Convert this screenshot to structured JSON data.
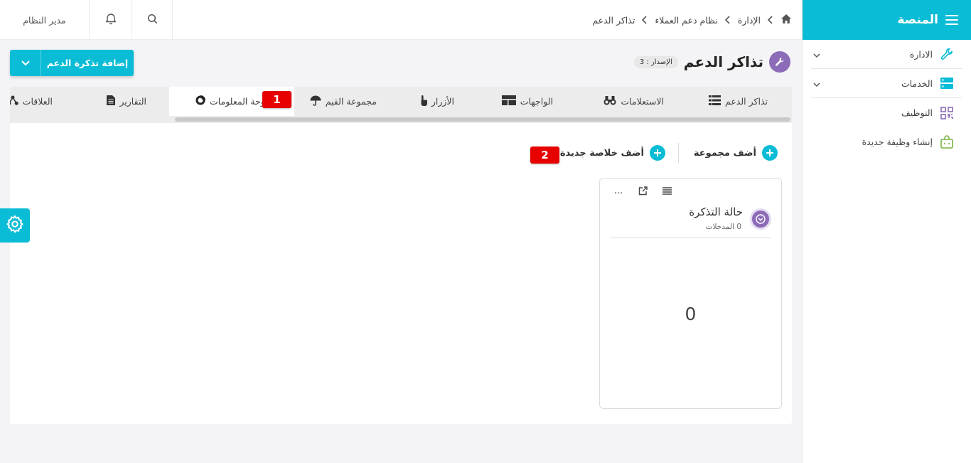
{
  "sidebar": {
    "title": "المنصة",
    "items": [
      {
        "label": "الادارة",
        "icon": "wrench-icon",
        "has_chevron": true
      },
      {
        "label": "الخدمات",
        "icon": "server-icon",
        "has_chevron": true
      },
      {
        "label": "التوظيف",
        "icon": "qr-grid-icon",
        "has_chevron": false
      },
      {
        "label": "إنشاء وظيفة جديدة",
        "icon": "shopping-bag-icon",
        "has_chevron": false
      }
    ]
  },
  "topbar": {
    "user": "مدير النظام",
    "breadcrumb": [
      "الإدارة",
      "نظام دعم العملاء",
      "تذاكر الدعم"
    ]
  },
  "header": {
    "title": "تذاكر الدعم",
    "version": "الإصدار : 3",
    "add_button": "إضافة تذكرة الدعم"
  },
  "tabs": [
    {
      "label": "تذاكر الدعم",
      "icon": "list-icon"
    },
    {
      "label": "الاستعلامات",
      "icon": "binoculars-icon"
    },
    {
      "label": "الواجهات",
      "icon": "layout-icon"
    },
    {
      "label": "الأزرار",
      "icon": "pointer-hand-icon"
    },
    {
      "label": "مجموعة القيم",
      "icon": "umbrella-icon"
    },
    {
      "label": "لوحة المعلومات",
      "icon": "donut-chart-icon",
      "active": true
    },
    {
      "label": "التقارير",
      "icon": "document-icon"
    },
    {
      "label": "العلاقات",
      "icon": "network-icon"
    }
  ],
  "actions": {
    "add_group": "أضف مجموعة",
    "add_summary": "أضف خلاصة جديدة"
  },
  "annotations": [
    "1",
    "2"
  ],
  "widget": {
    "title": "حالة التذكرة",
    "entries": "0 المدخلات",
    "value": "0",
    "menu": "..."
  },
  "colors": {
    "accent": "#0bbcd6",
    "purple": "#8c6bb8",
    "badge_red": "#e60000",
    "bag_green": "#7cb342"
  }
}
